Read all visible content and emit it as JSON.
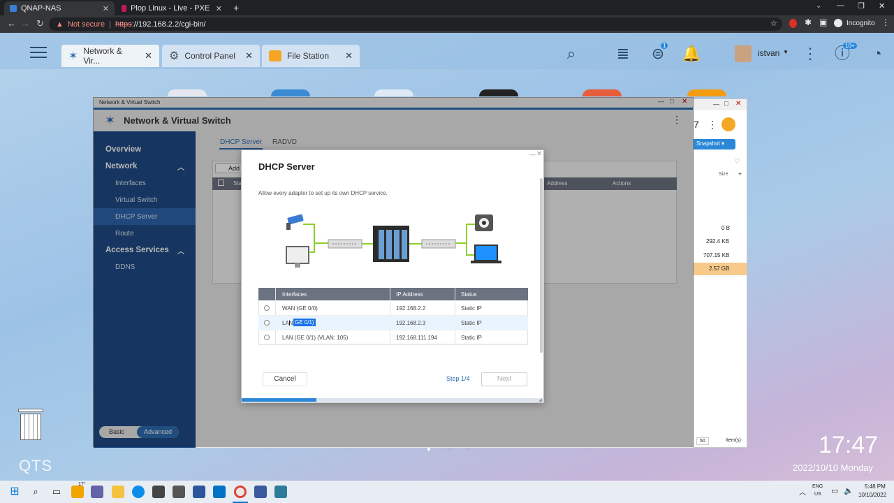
{
  "browser": {
    "tabs": [
      {
        "label": "QNAP-NAS",
        "active": true
      },
      {
        "label": "Plop Linux - Live - PXE Boot from",
        "active": false
      }
    ],
    "security_label": "Not secure",
    "url_scheme": "https",
    "url_rest": "://192.168.2.2/cgi-bin/",
    "profile_label": "Incognito"
  },
  "qts": {
    "app_tabs": [
      {
        "label": "Network & Vir...",
        "icon": "network-switch-icon"
      },
      {
        "label": "Control Panel",
        "icon": "gear-icon"
      },
      {
        "label": "File Station",
        "icon": "folder-icon"
      }
    ],
    "user": "istvan",
    "notification_badge": "1",
    "update_badge": "10+",
    "brand": "QTS",
    "clock_time": "17:47",
    "clock_date": "2022/10/10 Monday"
  },
  "nvs_window": {
    "title": "Network & Virtual Switch",
    "header": "Network & Virtual Switch",
    "sidebar": {
      "overview": "Overview",
      "network": "Network",
      "interfaces": "Interfaces",
      "virtual_switch": "Virtual Switch",
      "dhcp_server": "DHCP Server",
      "route": "Route",
      "access_services": "Access Services",
      "ddns": "DDNS"
    },
    "mode": {
      "basic": "Basic",
      "advanced": "Advanced"
    },
    "tabs": {
      "dhcp": "DHCP Server",
      "radvd": "RADVD"
    },
    "toolbar_add": "Add",
    "col_status_partial": "Sta",
    "col_address": "Address",
    "col_actions": "Actions"
  },
  "modal": {
    "title": "DHCP Server",
    "description": "Allow every adapter to set up its own DHCP service.",
    "table": {
      "headers": [
        "Interfaces",
        "IP Address",
        "Status"
      ],
      "rows": [
        {
          "interface": "WAN (GE 0/0)",
          "ip": "192.168.2.2",
          "status": "Static IP"
        },
        {
          "interface_prefix": "LAN",
          "interface_highlight": " GE 0/1)",
          "ip": "192.168.2.3",
          "status": "Static IP"
        },
        {
          "interface": "LAN (GE 0/1) (VLAN: 105)",
          "ip": "192.168.111.194",
          "status": "Static IP"
        }
      ]
    },
    "cancel": "Cancel",
    "step": "Step 1/4",
    "next": "Next",
    "progress": 0.25
  },
  "file_station": {
    "partial_title": "7",
    "snapshot": "Snapshot",
    "col_size": "Size",
    "sizes": [
      "0 B",
      "292.4 KB",
      "707.15 KB",
      "2.57 GB"
    ],
    "per_page": "50",
    "items_label": "Item(s)"
  },
  "taskbar": {
    "lang": "ENG",
    "region": "US",
    "time": "5:48 PM",
    "date": "10/10/2022",
    "weather": "17°"
  }
}
